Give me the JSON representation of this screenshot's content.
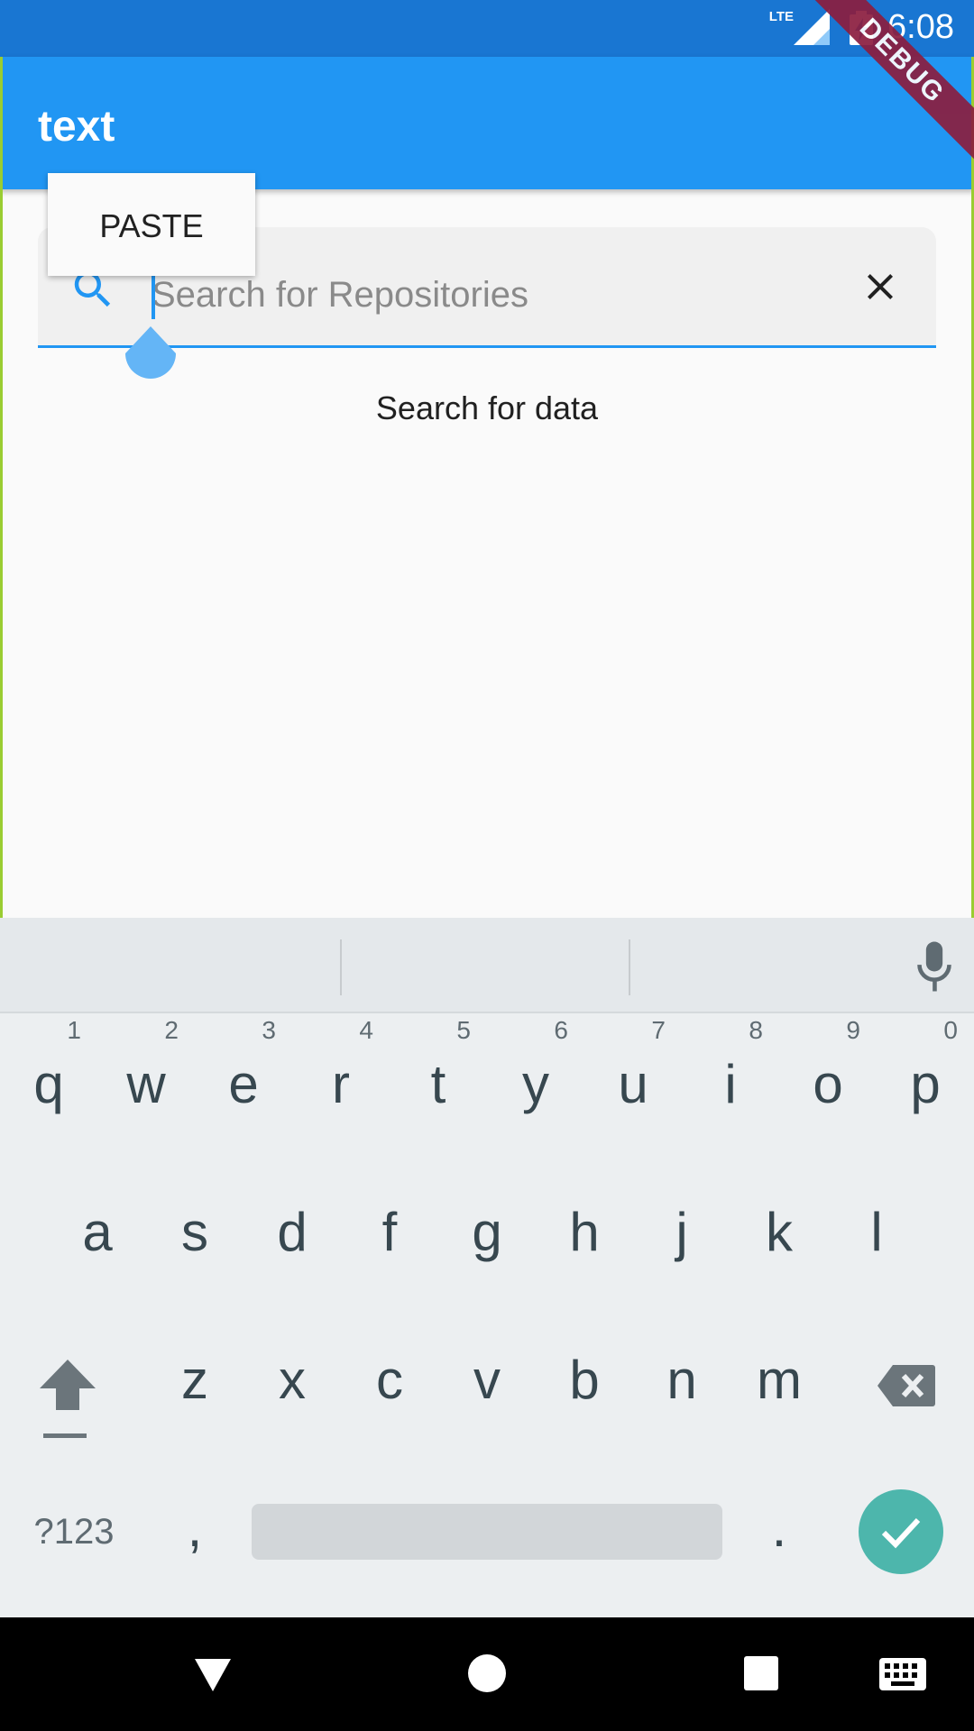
{
  "status_bar": {
    "time": "6:08",
    "network": "LTE",
    "icons": [
      "signal-icon",
      "battery-charging-icon"
    ]
  },
  "app_bar": {
    "title": "text",
    "debug_banner": "DEBUG"
  },
  "context_menu": {
    "paste_label": "PASTE"
  },
  "search": {
    "placeholder": "Search for Repositories",
    "value": ""
  },
  "result": {
    "message": "Search for data"
  },
  "keyboard": {
    "row1": [
      {
        "key": "q",
        "hint": "1"
      },
      {
        "key": "w",
        "hint": "2"
      },
      {
        "key": "e",
        "hint": "3"
      },
      {
        "key": "r",
        "hint": "4"
      },
      {
        "key": "t",
        "hint": "5"
      },
      {
        "key": "y",
        "hint": "6"
      },
      {
        "key": "u",
        "hint": "7"
      },
      {
        "key": "i",
        "hint": "8"
      },
      {
        "key": "o",
        "hint": "9"
      },
      {
        "key": "p",
        "hint": "0"
      }
    ],
    "row2": [
      "a",
      "s",
      "d",
      "f",
      "g",
      "h",
      "j",
      "k",
      "l"
    ],
    "row3": [
      "z",
      "x",
      "c",
      "v",
      "b",
      "n",
      "m"
    ],
    "symbols_label": "?123",
    "comma": ",",
    "period": "."
  },
  "colors": {
    "app_bar": "#2196f3",
    "status_bar": "#1976d2",
    "accent": "#2196f3",
    "enter_key": "#4db6ac",
    "debug": "#8b1e3f"
  }
}
